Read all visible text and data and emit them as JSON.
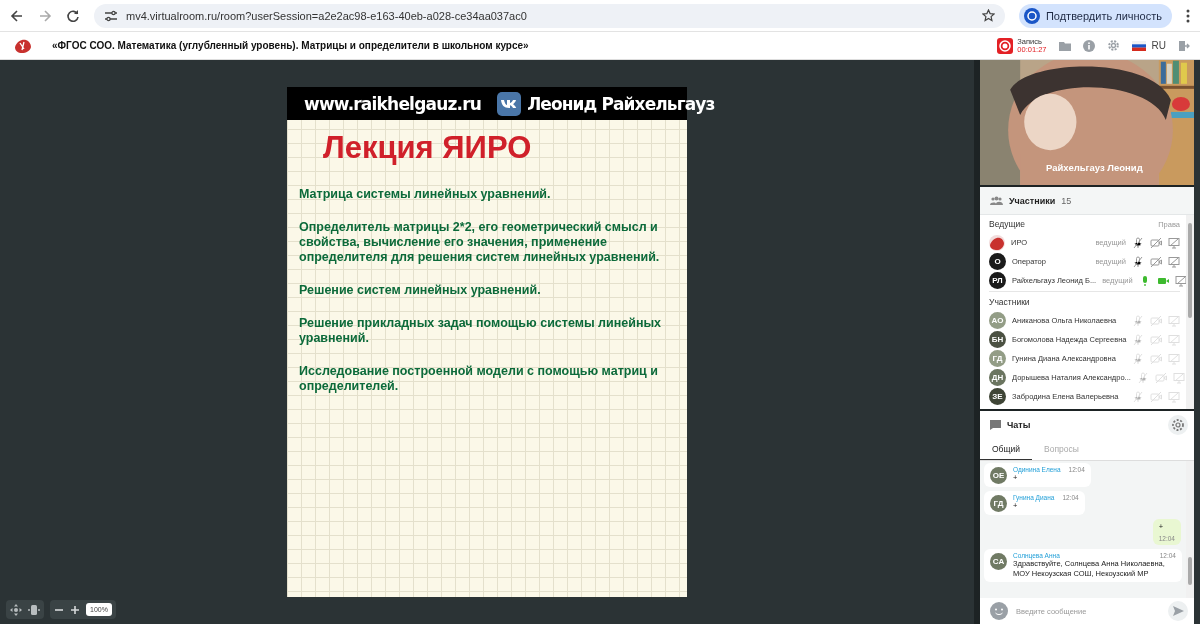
{
  "browser": {
    "url": "mv4.virtualroom.ru/room?userSession=a2e2ac98-e163-40eb-a028-ce34aa037ac0",
    "verify_button": "Подтвердить личность"
  },
  "header": {
    "title": "«ФГОС СОО. Математика (углубленный уровень). Матрицы и определители в школьном курсе»",
    "recording_label": "Запись",
    "recording_time": "00:01:27",
    "language": "RU"
  },
  "slide": {
    "site": "www.raikhelgauz.ru",
    "author": "Леонид Райхельгауз",
    "heading": "Лекция ЯИРО",
    "items": [
      "Матрица системы линейных уравнений.",
      "Определитель матрицы 2*2, его геометрический смысл и свойства, вычисление его значения, применение определителя  для решения систем линейных уравнений.",
      "Решение систем линейных уравнений.",
      "Решение прикладных задач    помощью системы линейных уравнений.",
      "Исследование построенной модели с помощью матриц и определителей."
    ]
  },
  "zoom_controls": {
    "zoom": "100%"
  },
  "video": {
    "name": "Райхельгауз Леонид"
  },
  "participants": {
    "title": "Участники",
    "count": "15",
    "hosts_heading": "Ведущие",
    "rights_label": "Права",
    "hosts": [
      {
        "kind": "logo",
        "name": "ИРО",
        "role": "ведущий",
        "mic_on": false,
        "cam_on": false
      },
      {
        "kind": "initials",
        "initials": "О",
        "name": "Оператор",
        "role": "ведущий",
        "mic_on": false,
        "cam_on": false
      },
      {
        "kind": "initials",
        "initials": "РЛ",
        "name": "Райхельгауз Леонид Б...",
        "role": "ведущий",
        "mic_on": true,
        "cam_on": true
      }
    ],
    "members_heading": "Участники",
    "members": [
      {
        "initials": "АО",
        "name": "Аниканова Ольга Николаевна",
        "color": "#939d86"
      },
      {
        "initials": "БН",
        "name": "Богомолова Надежда Сергеевна",
        "color": "#4b5142"
      },
      {
        "initials": "ГД",
        "name": "Гунина Диана Александровна",
        "color": "#939d86"
      },
      {
        "initials": "ДН",
        "name": "Дорышева Наталия Александро...",
        "color": "#6b7560"
      },
      {
        "initials": "ЗЕ",
        "name": "Забродина Елена Валерьевна",
        "color": "#3f4536"
      }
    ]
  },
  "chat": {
    "title": "Чаты",
    "tabs": [
      {
        "label": "Общий",
        "selected": true
      },
      {
        "label": "Вопросы",
        "selected": false
      }
    ],
    "messages": [
      {
        "kind": "incoming",
        "initials": "ОЕ",
        "author": "Одинина Елена",
        "time": "12:04",
        "text": "+"
      },
      {
        "kind": "incoming",
        "initials": "ГД",
        "author": "Гунина Диана",
        "time": "12:04",
        "text": "+"
      },
      {
        "kind": "outgoing",
        "time": "12:04",
        "text": "+"
      },
      {
        "kind": "incoming",
        "initials": "СА",
        "author": "Солнцева Анна",
        "time": "12:04",
        "text": "Здравствуйте, Солнцева Анна Николаевна, МОУ Некоузская СОШ, Некоузский МР"
      }
    ],
    "placeholder": "Введите сообщение"
  }
}
